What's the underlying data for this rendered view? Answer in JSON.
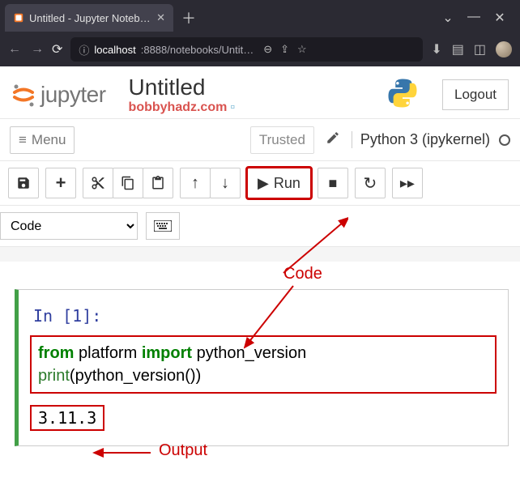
{
  "browser": {
    "tab_title": "Untitled - Jupyter Notebook",
    "url_host": "localhost",
    "url_port_path": ":8888/notebooks/Untit…"
  },
  "header": {
    "logo_text": "jupyter",
    "title": "Untitled",
    "subtitle": "bobbyhadz.com",
    "logout": "Logout"
  },
  "menubar": {
    "menu": "Menu",
    "trusted": "Trusted",
    "kernel": "Python 3 (ipykernel)"
  },
  "toolbar": {
    "run_label": "Run",
    "celltype": "Code"
  },
  "cell": {
    "prompt": "In [1]:",
    "code_line1_kw1": "from",
    "code_line1_mod": " platform ",
    "code_line1_kw2": "import",
    "code_line1_imp": " python_version",
    "code_line2_fn": "print",
    "code_line2_open": "(",
    "code_line2_call": "python_version",
    "code_line2_paren": "()",
    "code_line2_close": ")",
    "output": "3.11.3"
  },
  "annotations": {
    "code_label": "Code",
    "output_label": "Output"
  }
}
